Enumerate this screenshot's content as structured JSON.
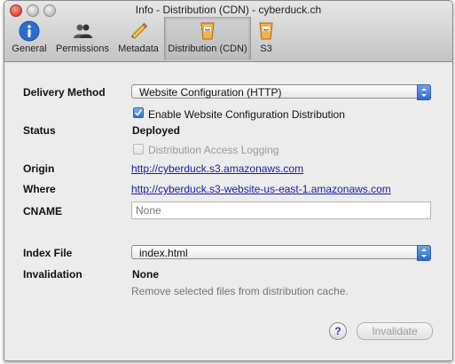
{
  "window": {
    "title": "Info - Distribution (CDN) - cyberduck.ch"
  },
  "toolbar": {
    "items": [
      {
        "label": "General",
        "icon": "info-icon"
      },
      {
        "label": "Permissions",
        "icon": "users-icon"
      },
      {
        "label": "Metadata",
        "icon": "pencil-icon"
      },
      {
        "label": "Distribution (CDN)",
        "icon": "amazon-bucket-icon",
        "selected": true
      },
      {
        "label": "S3",
        "icon": "amazon-bucket-icon"
      }
    ]
  },
  "form": {
    "delivery_method_label": "Delivery Method",
    "delivery_method_value": "Website Configuration (HTTP)",
    "enable_checkbox_label": "Enable Website Configuration Distribution",
    "status_label": "Status",
    "status_value": "Deployed",
    "logging_checkbox_label": "Distribution Access Logging",
    "origin_label": "Origin",
    "origin_value": "http://cyberduck.s3.amazonaws.com",
    "where_label": "Where",
    "where_value": "http://cyberduck.s3-website-us-east-1.amazonaws.com",
    "cname_label": "CNAME",
    "cname_placeholder": "None",
    "index_file_label": "Index File",
    "index_file_value": "index.html",
    "invalidation_label": "Invalidation",
    "invalidation_value": "None",
    "invalidation_hint": "Remove selected files from distribution cache.",
    "help_label": "?",
    "invalidate_button": "Invalidate"
  },
  "colors": {
    "link": "#1a1aa6",
    "accent": "#2d6fd6"
  }
}
